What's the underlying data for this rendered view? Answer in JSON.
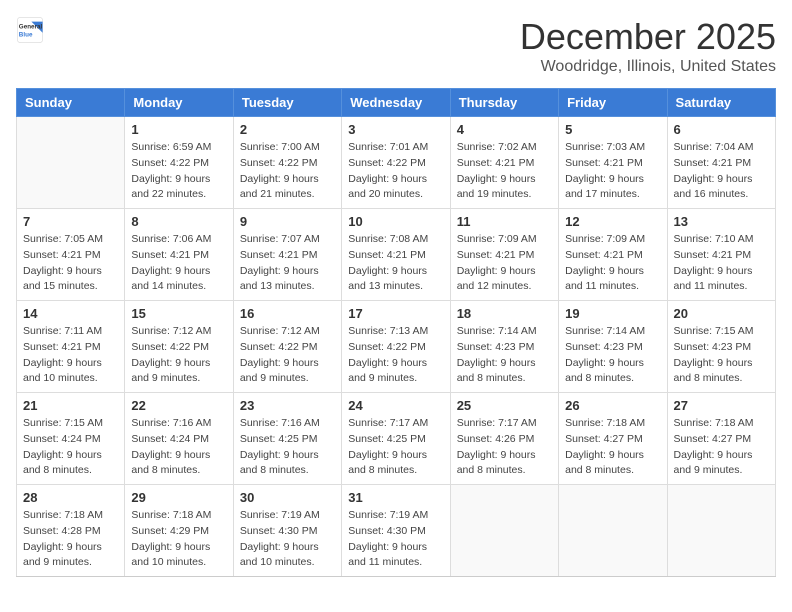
{
  "header": {
    "logo_general": "General",
    "logo_blue": "Blue",
    "month_title": "December 2025",
    "location": "Woodridge, Illinois, United States"
  },
  "days_of_week": [
    "Sunday",
    "Monday",
    "Tuesday",
    "Wednesday",
    "Thursday",
    "Friday",
    "Saturday"
  ],
  "weeks": [
    [
      {
        "day": "",
        "sunrise": "",
        "sunset": "",
        "daylight": ""
      },
      {
        "day": "1",
        "sunrise": "Sunrise: 6:59 AM",
        "sunset": "Sunset: 4:22 PM",
        "daylight": "Daylight: 9 hours and 22 minutes."
      },
      {
        "day": "2",
        "sunrise": "Sunrise: 7:00 AM",
        "sunset": "Sunset: 4:22 PM",
        "daylight": "Daylight: 9 hours and 21 minutes."
      },
      {
        "day": "3",
        "sunrise": "Sunrise: 7:01 AM",
        "sunset": "Sunset: 4:22 PM",
        "daylight": "Daylight: 9 hours and 20 minutes."
      },
      {
        "day": "4",
        "sunrise": "Sunrise: 7:02 AM",
        "sunset": "Sunset: 4:21 PM",
        "daylight": "Daylight: 9 hours and 19 minutes."
      },
      {
        "day": "5",
        "sunrise": "Sunrise: 7:03 AM",
        "sunset": "Sunset: 4:21 PM",
        "daylight": "Daylight: 9 hours and 17 minutes."
      },
      {
        "day": "6",
        "sunrise": "Sunrise: 7:04 AM",
        "sunset": "Sunset: 4:21 PM",
        "daylight": "Daylight: 9 hours and 16 minutes."
      }
    ],
    [
      {
        "day": "7",
        "sunrise": "Sunrise: 7:05 AM",
        "sunset": "Sunset: 4:21 PM",
        "daylight": "Daylight: 9 hours and 15 minutes."
      },
      {
        "day": "8",
        "sunrise": "Sunrise: 7:06 AM",
        "sunset": "Sunset: 4:21 PM",
        "daylight": "Daylight: 9 hours and 14 minutes."
      },
      {
        "day": "9",
        "sunrise": "Sunrise: 7:07 AM",
        "sunset": "Sunset: 4:21 PM",
        "daylight": "Daylight: 9 hours and 13 minutes."
      },
      {
        "day": "10",
        "sunrise": "Sunrise: 7:08 AM",
        "sunset": "Sunset: 4:21 PM",
        "daylight": "Daylight: 9 hours and 13 minutes."
      },
      {
        "day": "11",
        "sunrise": "Sunrise: 7:09 AM",
        "sunset": "Sunset: 4:21 PM",
        "daylight": "Daylight: 9 hours and 12 minutes."
      },
      {
        "day": "12",
        "sunrise": "Sunrise: 7:09 AM",
        "sunset": "Sunset: 4:21 PM",
        "daylight": "Daylight: 9 hours and 11 minutes."
      },
      {
        "day": "13",
        "sunrise": "Sunrise: 7:10 AM",
        "sunset": "Sunset: 4:21 PM",
        "daylight": "Daylight: 9 hours and 11 minutes."
      }
    ],
    [
      {
        "day": "14",
        "sunrise": "Sunrise: 7:11 AM",
        "sunset": "Sunset: 4:21 PM",
        "daylight": "Daylight: 9 hours and 10 minutes."
      },
      {
        "day": "15",
        "sunrise": "Sunrise: 7:12 AM",
        "sunset": "Sunset: 4:22 PM",
        "daylight": "Daylight: 9 hours and 9 minutes."
      },
      {
        "day": "16",
        "sunrise": "Sunrise: 7:12 AM",
        "sunset": "Sunset: 4:22 PM",
        "daylight": "Daylight: 9 hours and 9 minutes."
      },
      {
        "day": "17",
        "sunrise": "Sunrise: 7:13 AM",
        "sunset": "Sunset: 4:22 PM",
        "daylight": "Daylight: 9 hours and 9 minutes."
      },
      {
        "day": "18",
        "sunrise": "Sunrise: 7:14 AM",
        "sunset": "Sunset: 4:23 PM",
        "daylight": "Daylight: 9 hours and 8 minutes."
      },
      {
        "day": "19",
        "sunrise": "Sunrise: 7:14 AM",
        "sunset": "Sunset: 4:23 PM",
        "daylight": "Daylight: 9 hours and 8 minutes."
      },
      {
        "day": "20",
        "sunrise": "Sunrise: 7:15 AM",
        "sunset": "Sunset: 4:23 PM",
        "daylight": "Daylight: 9 hours and 8 minutes."
      }
    ],
    [
      {
        "day": "21",
        "sunrise": "Sunrise: 7:15 AM",
        "sunset": "Sunset: 4:24 PM",
        "daylight": "Daylight: 9 hours and 8 minutes."
      },
      {
        "day": "22",
        "sunrise": "Sunrise: 7:16 AM",
        "sunset": "Sunset: 4:24 PM",
        "daylight": "Daylight: 9 hours and 8 minutes."
      },
      {
        "day": "23",
        "sunrise": "Sunrise: 7:16 AM",
        "sunset": "Sunset: 4:25 PM",
        "daylight": "Daylight: 9 hours and 8 minutes."
      },
      {
        "day": "24",
        "sunrise": "Sunrise: 7:17 AM",
        "sunset": "Sunset: 4:25 PM",
        "daylight": "Daylight: 9 hours and 8 minutes."
      },
      {
        "day": "25",
        "sunrise": "Sunrise: 7:17 AM",
        "sunset": "Sunset: 4:26 PM",
        "daylight": "Daylight: 9 hours and 8 minutes."
      },
      {
        "day": "26",
        "sunrise": "Sunrise: 7:18 AM",
        "sunset": "Sunset: 4:27 PM",
        "daylight": "Daylight: 9 hours and 8 minutes."
      },
      {
        "day": "27",
        "sunrise": "Sunrise: 7:18 AM",
        "sunset": "Sunset: 4:27 PM",
        "daylight": "Daylight: 9 hours and 9 minutes."
      }
    ],
    [
      {
        "day": "28",
        "sunrise": "Sunrise: 7:18 AM",
        "sunset": "Sunset: 4:28 PM",
        "daylight": "Daylight: 9 hours and 9 minutes."
      },
      {
        "day": "29",
        "sunrise": "Sunrise: 7:18 AM",
        "sunset": "Sunset: 4:29 PM",
        "daylight": "Daylight: 9 hours and 10 minutes."
      },
      {
        "day": "30",
        "sunrise": "Sunrise: 7:19 AM",
        "sunset": "Sunset: 4:30 PM",
        "daylight": "Daylight: 9 hours and 10 minutes."
      },
      {
        "day": "31",
        "sunrise": "Sunrise: 7:19 AM",
        "sunset": "Sunset: 4:30 PM",
        "daylight": "Daylight: 9 hours and 11 minutes."
      },
      {
        "day": "",
        "sunrise": "",
        "sunset": "",
        "daylight": ""
      },
      {
        "day": "",
        "sunrise": "",
        "sunset": "",
        "daylight": ""
      },
      {
        "day": "",
        "sunrise": "",
        "sunset": "",
        "daylight": ""
      }
    ]
  ]
}
